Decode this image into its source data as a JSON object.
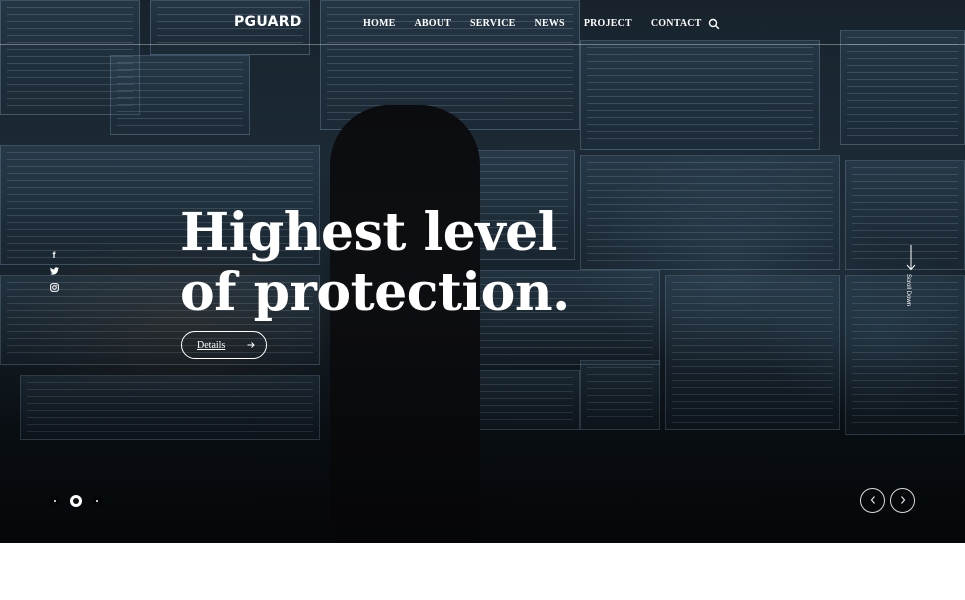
{
  "brand": {
    "logo_text": "PGUARD"
  },
  "nav": {
    "items": [
      "HOME",
      "ABOUT",
      "SERVICE",
      "NEWS",
      "PROJECT",
      "CONTACT"
    ]
  },
  "icons": {
    "search": "search-icon",
    "social": [
      "facebook-icon",
      "twitter-icon",
      "instagram-icon"
    ],
    "facebook_glyph": "f"
  },
  "hero": {
    "title_line1": "Highest level",
    "title_line2": "of protection.",
    "cta_label": "Details",
    "scroll_label": "Scroll Down"
  },
  "slider": {
    "slide_count": 3,
    "active_index": 1
  },
  "colors": {
    "text": "#ffffff",
    "hero_bg": "#1f2f3c",
    "page_bg": "#ffffff"
  }
}
